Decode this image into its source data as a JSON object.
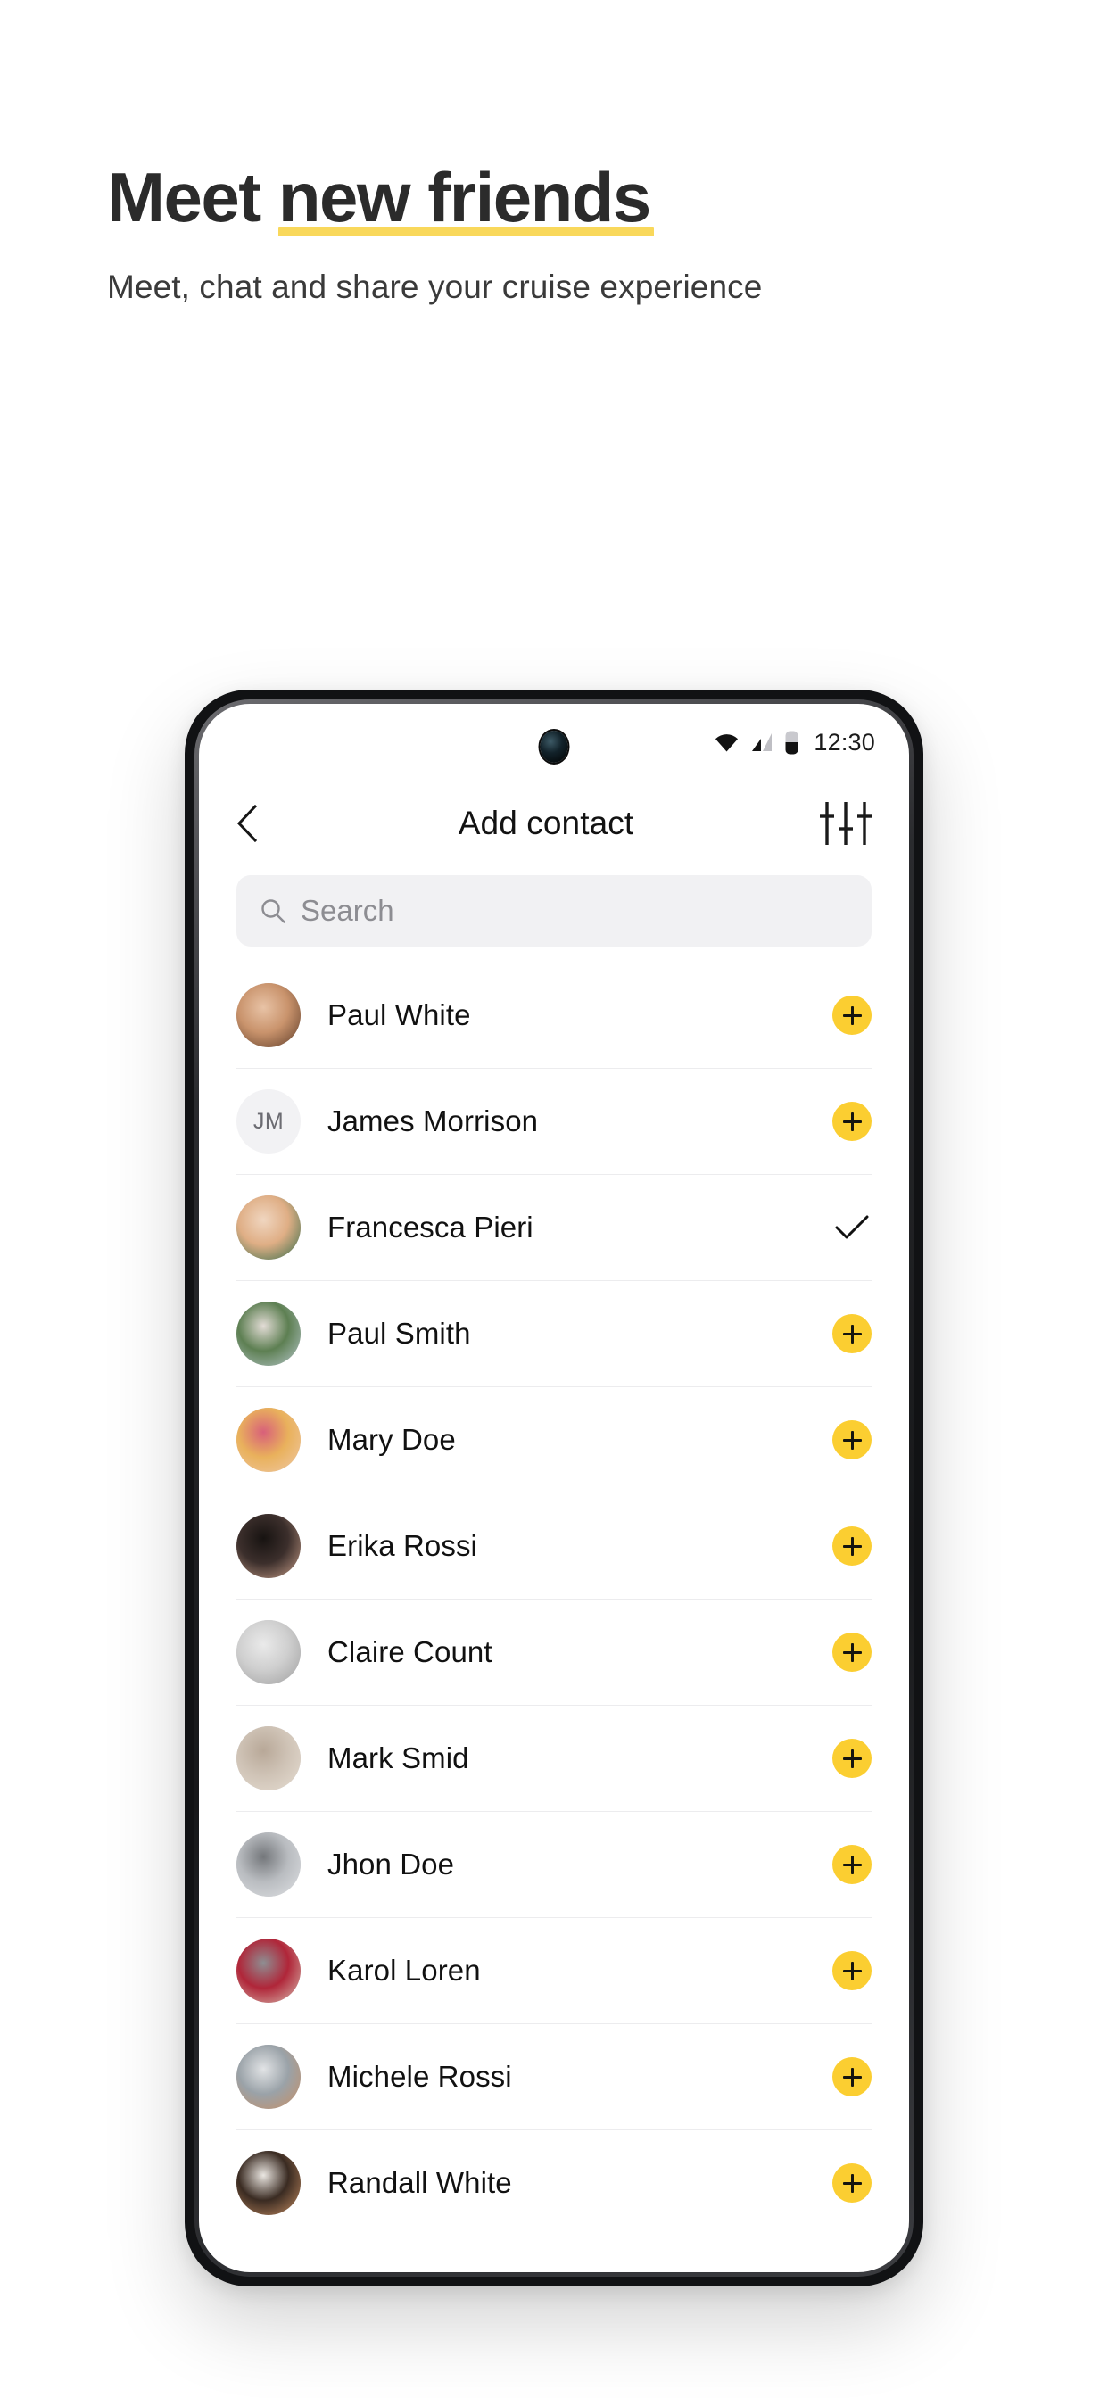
{
  "promo": {
    "title_plain": "Meet ",
    "title_highlight": "new friends",
    "subtitle": "Meet, chat and share your cruise experience"
  },
  "colors": {
    "accent_yellow": "#FBCE31",
    "highlight_underline": "#F9D85B",
    "text_dark": "#2b2b2b",
    "search_bg": "#f1f1f3"
  },
  "phone": {
    "status_bar": {
      "time": "12:30",
      "icons": [
        "wifi-icon",
        "cellular-signal-icon",
        "battery-icon"
      ]
    },
    "app_bar": {
      "back_icon": "chevron-left-icon",
      "title": "Add contact",
      "filter_icon": "sliders-filter-icon"
    },
    "search": {
      "icon": "search-icon",
      "placeholder": "Search",
      "value": ""
    },
    "contacts": [
      {
        "name": "Paul White",
        "avatar_type": "photo",
        "initials": "",
        "action": "add",
        "action_label": "+"
      },
      {
        "name": "James Morrison",
        "avatar_type": "initials",
        "initials": "JM",
        "action": "add",
        "action_label": "+"
      },
      {
        "name": "Francesca Pieri",
        "avatar_type": "photo",
        "initials": "",
        "action": "added",
        "action_label": "✓"
      },
      {
        "name": "Paul Smith",
        "avatar_type": "photo",
        "initials": "",
        "action": "add",
        "action_label": "+"
      },
      {
        "name": "Mary Doe",
        "avatar_type": "photo",
        "initials": "",
        "action": "add",
        "action_label": "+"
      },
      {
        "name": "Erika Rossi",
        "avatar_type": "photo",
        "initials": "",
        "action": "add",
        "action_label": "+"
      },
      {
        "name": "Claire Count",
        "avatar_type": "photo",
        "initials": "",
        "action": "add",
        "action_label": "+"
      },
      {
        "name": "Mark Smid",
        "avatar_type": "photo",
        "initials": "",
        "action": "add",
        "action_label": "+"
      },
      {
        "name": "Jhon Doe",
        "avatar_type": "photo",
        "initials": "",
        "action": "add",
        "action_label": "+"
      },
      {
        "name": "Karol Loren",
        "avatar_type": "photo",
        "initials": "",
        "action": "add",
        "action_label": "+"
      },
      {
        "name": "Michele Rossi",
        "avatar_type": "photo",
        "initials": "",
        "action": "add",
        "action_label": "+"
      },
      {
        "name": "Randall White",
        "avatar_type": "photo",
        "initials": "",
        "action": "add",
        "action_label": "+"
      }
    ]
  }
}
